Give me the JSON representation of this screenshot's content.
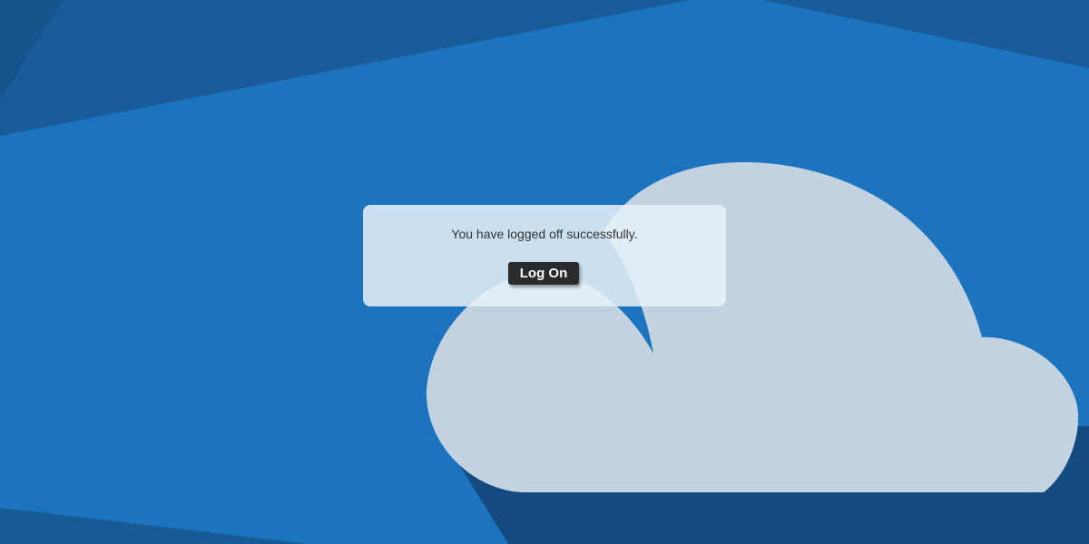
{
  "theme": {
    "background_color": "#1b74bd",
    "dark_blue": "#1a5c99",
    "darker_blue": "#134a80",
    "cloud_color": "#c3d2e0",
    "dialog_background": "#e8f1f8",
    "button_color": "#2b2b2b"
  },
  "background": {
    "cloud_icon": "cloud-icon"
  },
  "dialog": {
    "message": "You have logged off successfully.",
    "logon_button_label": "Log On"
  }
}
